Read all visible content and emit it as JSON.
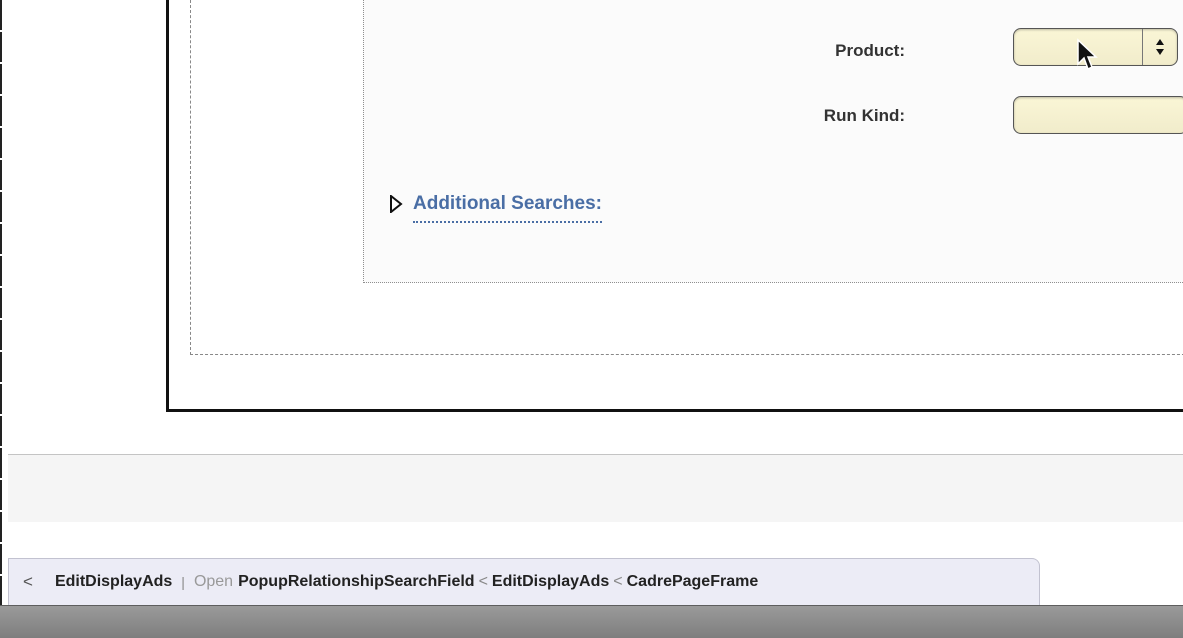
{
  "form": {
    "product_label": "Product:",
    "product_value": "",
    "run_kind_label": "Run Kind:",
    "run_kind_value": "",
    "additional_searches_label": "Additional Searches:"
  },
  "colors": {
    "field_bg": "#f6f1d0",
    "link": "#4a6ea5",
    "tab_bg": "#ececf6",
    "bottom_bar": "#8a8a8a"
  },
  "breadcrumb": {
    "back_glyph": "<",
    "current": "EditDisplayAds",
    "separator": "|",
    "open_label": "Open",
    "path": [
      "PopupRelationshipSearchField",
      "EditDisplayAds",
      "CadrePageFrame"
    ],
    "path_separator": "<"
  },
  "icons": {
    "select_arrows": "up-down-arrows-icon",
    "disclosure": "disclosure-triangle-icon",
    "cursor": "mouse-pointer-icon"
  }
}
